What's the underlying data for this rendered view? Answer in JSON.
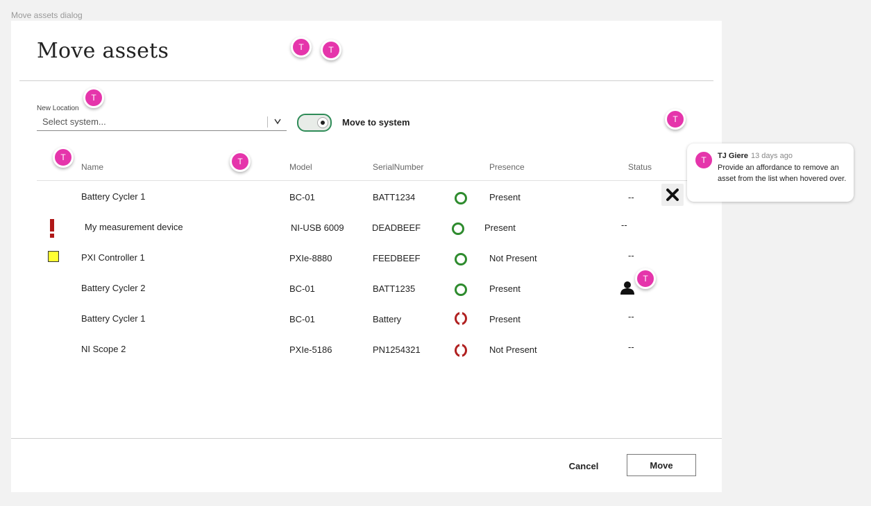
{
  "frame_label": "Move assets dialog",
  "dialog": {
    "title": "Move assets",
    "location_label": "New Location",
    "location_placeholder": "Select system...",
    "toggle_label": "Move to system",
    "toggle_on": true,
    "columns": [
      "Name",
      "Model",
      "SerialNumber",
      "Presence",
      "Status"
    ],
    "rows": [
      {
        "name": "Battery Cycler 1",
        "model": "BC-01",
        "serial": "BATT1234",
        "presence": "Present",
        "presence_icon": "present-ring-icon",
        "status": "--",
        "row_icon": ""
      },
      {
        "name": "My measurement device",
        "model": "NI-USB 6009",
        "serial": "DEADBEEF",
        "presence": "Present",
        "presence_icon": "present-ring-icon",
        "status": "--",
        "row_icon": "exclamation-icon"
      },
      {
        "name": "PXI Controller 1",
        "model": "PXIe-8880",
        "serial": "FEEDBEEF",
        "presence": "Not Present",
        "presence_icon": "present-ring-icon",
        "status": "--",
        "row_icon": "yellow-square-icon"
      },
      {
        "name": "Battery Cycler 2",
        "model": "BC-01",
        "serial": "BATT1235",
        "presence": "Present",
        "presence_icon": "present-ring-icon",
        "status": "person-icon",
        "row_icon": ""
      },
      {
        "name": "Battery Cycler 1",
        "model": "BC-01",
        "serial": "Battery",
        "presence": "Present",
        "presence_icon": "not-present-ring-icon",
        "status": "--",
        "row_icon": ""
      },
      {
        "name": "NI Scope 2",
        "model": "PXIe-5186",
        "serial": "PN1254321",
        "presence": "Not Present",
        "presence_icon": "not-present-ring-icon",
        "status": "--",
        "row_icon": ""
      }
    ],
    "cancel_label": "Cancel",
    "move_label": "Move"
  },
  "comment": {
    "avatar_initial": "T",
    "author": "TJ Giere",
    "time": "13 days ago",
    "text": "Provide an affordance to remove an asset from the list when hovered over."
  },
  "colors": {
    "present_green": "#2e8b2e",
    "not_present_red": "#b02020",
    "avatar_pink": "#e535ab",
    "toggle_green": "#2e8b57",
    "warning_yellow": "#ffff33"
  }
}
